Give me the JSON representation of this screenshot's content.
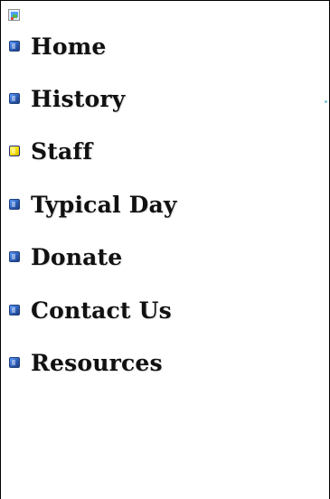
{
  "nav": {
    "items": [
      {
        "label": "Home",
        "bullet": "blue"
      },
      {
        "label": "History",
        "bullet": "blue"
      },
      {
        "label": "Staff",
        "bullet": "yellow"
      },
      {
        "label": "Typical Day",
        "bullet": "blue"
      },
      {
        "label": "Donate",
        "bullet": "blue"
      },
      {
        "label": "Contact Us",
        "bullet": "blue"
      },
      {
        "label": "Resources",
        "bullet": "blue"
      }
    ]
  },
  "icons": {
    "top_left": "broken-image-icon"
  },
  "colors": {
    "bullet_blue": "#2d5eb8",
    "bullet_yellow": "#f8e000",
    "text": "#111111",
    "border": "#000000"
  }
}
